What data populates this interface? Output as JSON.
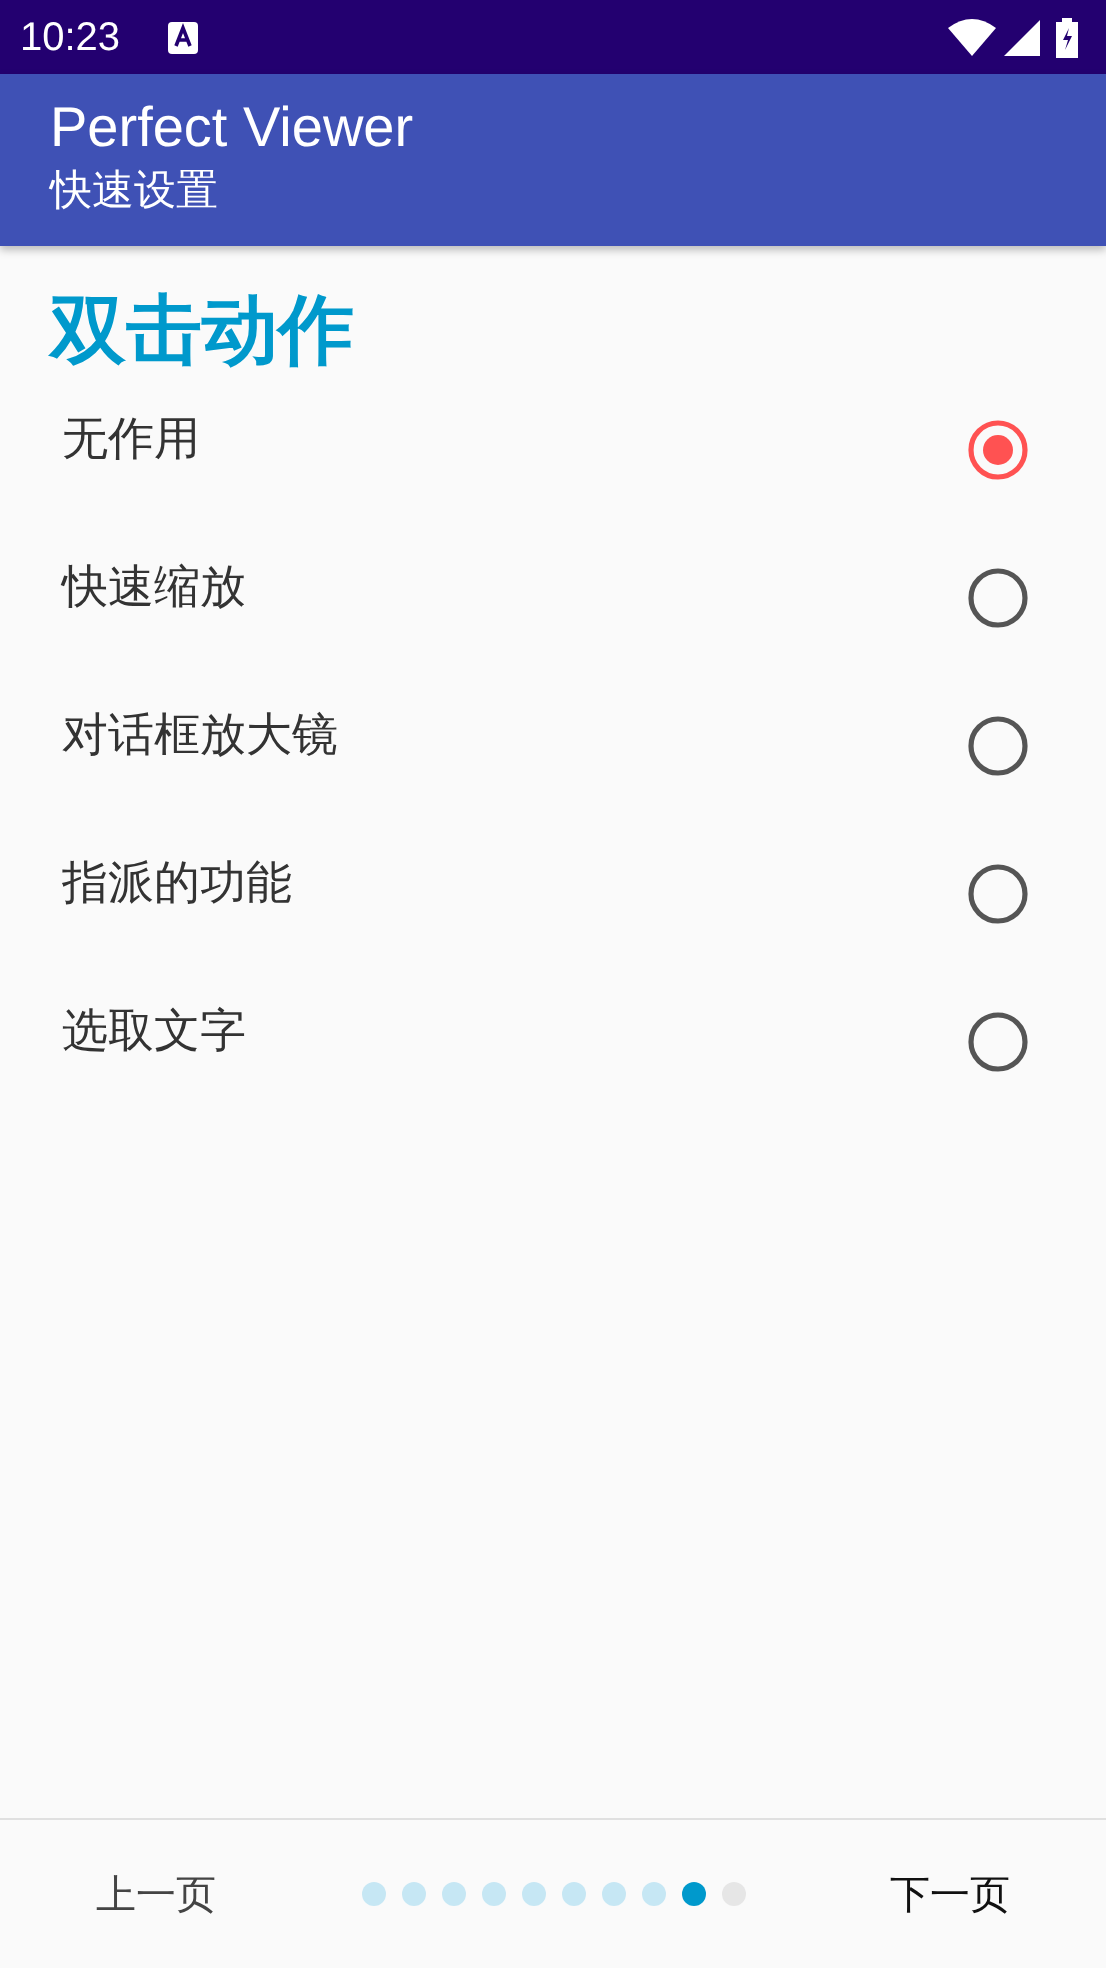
{
  "status_bar": {
    "time": "10:23"
  },
  "app_bar": {
    "title": "Perfect Viewer",
    "subtitle": "快速设置"
  },
  "section": {
    "title": "双击动作"
  },
  "options": [
    {
      "label": "无作用",
      "selected": true
    },
    {
      "label": "快速缩放",
      "selected": false
    },
    {
      "label": "对话框放大镜",
      "selected": false
    },
    {
      "label": "指派的功能",
      "selected": false
    },
    {
      "label": "选取文字",
      "selected": false
    }
  ],
  "footer": {
    "prev": "上一页",
    "next": "下一页",
    "pages": [
      {
        "kind": "done"
      },
      {
        "kind": "done"
      },
      {
        "kind": "done"
      },
      {
        "kind": "done"
      },
      {
        "kind": "done"
      },
      {
        "kind": "done"
      },
      {
        "kind": "done"
      },
      {
        "kind": "done"
      },
      {
        "kind": "current"
      },
      {
        "kind": "todo"
      }
    ]
  }
}
